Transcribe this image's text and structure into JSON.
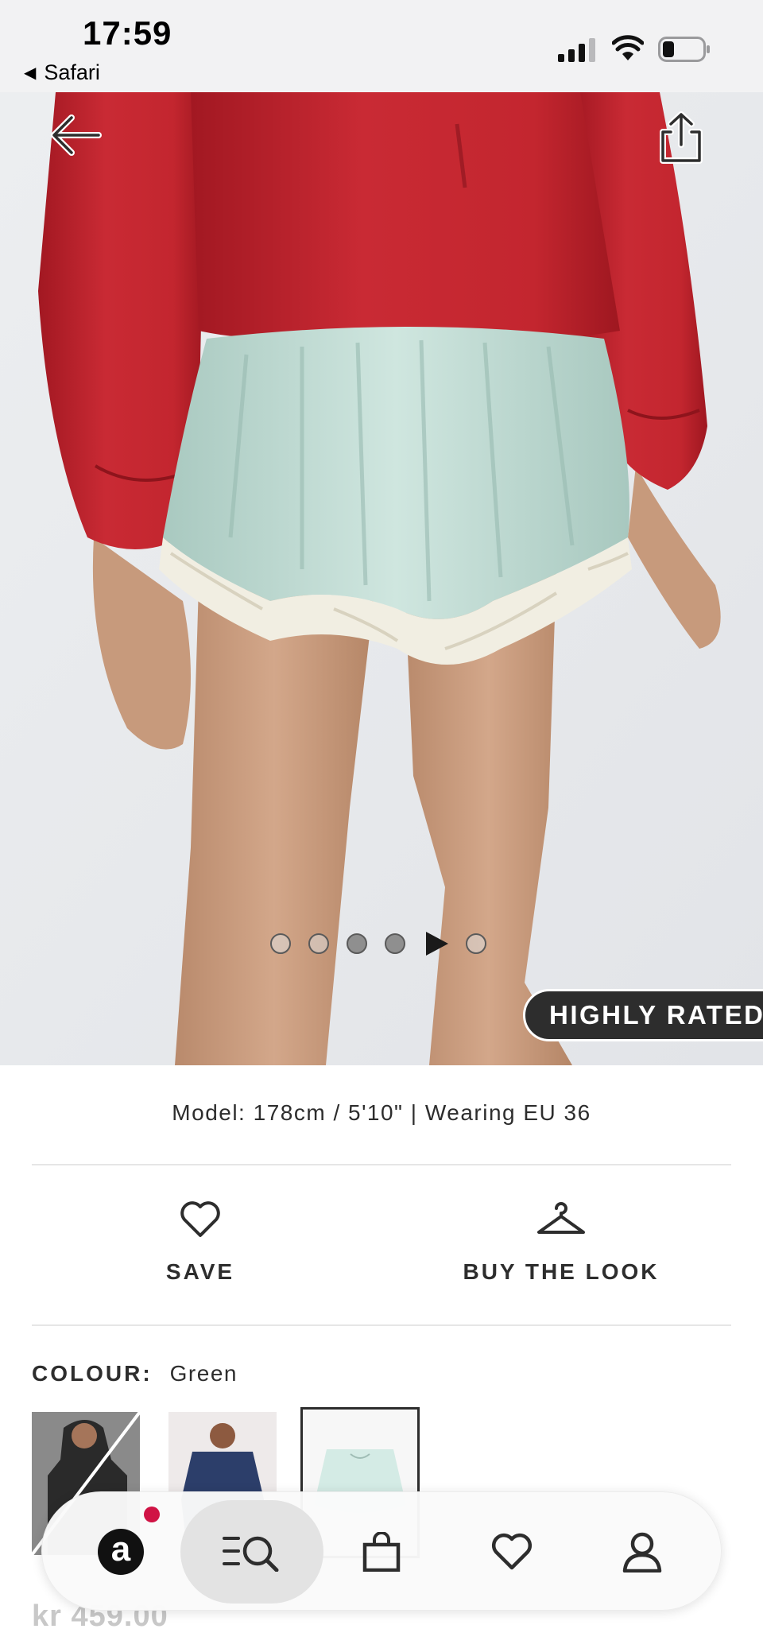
{
  "status_bar": {
    "time": "17:59",
    "back_app": "Safari"
  },
  "hero": {
    "badge": "HIGHLY RATED",
    "carousel": {
      "total": 6,
      "current_index": 4
    }
  },
  "product": {
    "model_info": "Model: 178cm / 5'10\" | Wearing EU 36",
    "actions": {
      "save_label": "SAVE",
      "buy_the_look_label": "BUY THE LOOK"
    },
    "colour": {
      "label": "COLOUR:",
      "value": "Green"
    },
    "price": "kr 459.00"
  },
  "icons": {
    "back": "back-arrow-icon",
    "share": "share-icon",
    "save": "heart-icon",
    "buy_the_look": "hanger-icon"
  },
  "bottom_nav": {
    "logo_letter": "a",
    "items": [
      "home",
      "search",
      "bag",
      "saved",
      "account"
    ],
    "active": "search"
  },
  "colors": {
    "accent_dark": "#2d2d2d",
    "notification": "#d01345",
    "price_muted": "#c8c8c8"
  }
}
